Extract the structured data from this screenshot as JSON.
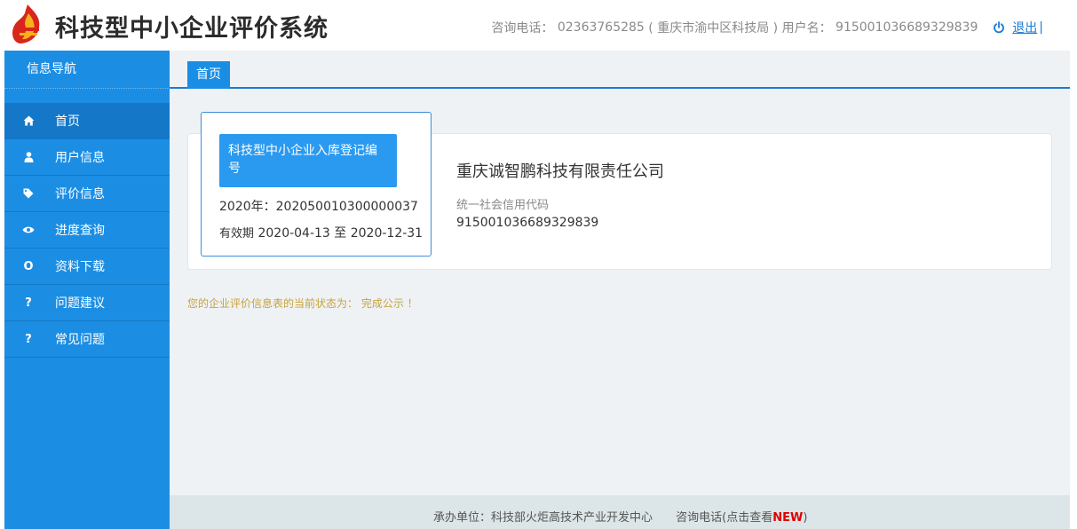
{
  "header": {
    "title": "科技型中小企业评价系统",
    "phone_label": "咨询电话：",
    "phone_number": "02363765285",
    "phone_note": "( 重庆市渝中区科技局 )",
    "user_label": "用户名：",
    "username": "915001036689329839",
    "logout_label": "退出",
    "separator": "|",
    "icons": {
      "logo": "logo-emblem-icon",
      "logout": "power-icon"
    }
  },
  "sidebar": {
    "title": "信息导航",
    "items": [
      {
        "label": "首页",
        "icon": "home-icon",
        "active": true
      },
      {
        "label": "用户信息",
        "icon": "user-icon",
        "active": false
      },
      {
        "label": "评价信息",
        "icon": "tag-icon",
        "active": false
      },
      {
        "label": "进度查询",
        "icon": "eye-icon",
        "active": false
      },
      {
        "label": "资料下载",
        "icon": "o-icon",
        "glyph": "O",
        "active": false
      },
      {
        "label": "问题建议",
        "icon": "question-icon",
        "glyph": "?",
        "active": false
      },
      {
        "label": "常见问题",
        "icon": "question-icon",
        "glyph": "?",
        "active": false
      }
    ]
  },
  "main": {
    "tab": "首页",
    "cert": {
      "button_label": "科技型中小企业入库登记编号",
      "year_line": "2020年：202050010300000037",
      "valid_label": "有效期",
      "valid_range": "2020-04-13 至 2020-12-31"
    },
    "company": {
      "name": "重庆诚智鹏科技有限责任公司",
      "credit_label": "统一社会信用代码",
      "credit_value": "915001036689329839"
    },
    "status_text": "您的企业评价信息表的当前状态为： 完成公示 ！"
  },
  "footer": {
    "org": "承办单位：科技部火炬高技术产业开发中心",
    "phone_link": "咨询电话(点击查看",
    "new_badge": "NEW",
    "close_paren": ")"
  },
  "colors": {
    "sidebar_bg": "#1b8ee4",
    "sidebar_active": "#1477c7",
    "accent": "#1a7bd3",
    "status": "#c8a33c",
    "new_badge": "#e00000"
  }
}
